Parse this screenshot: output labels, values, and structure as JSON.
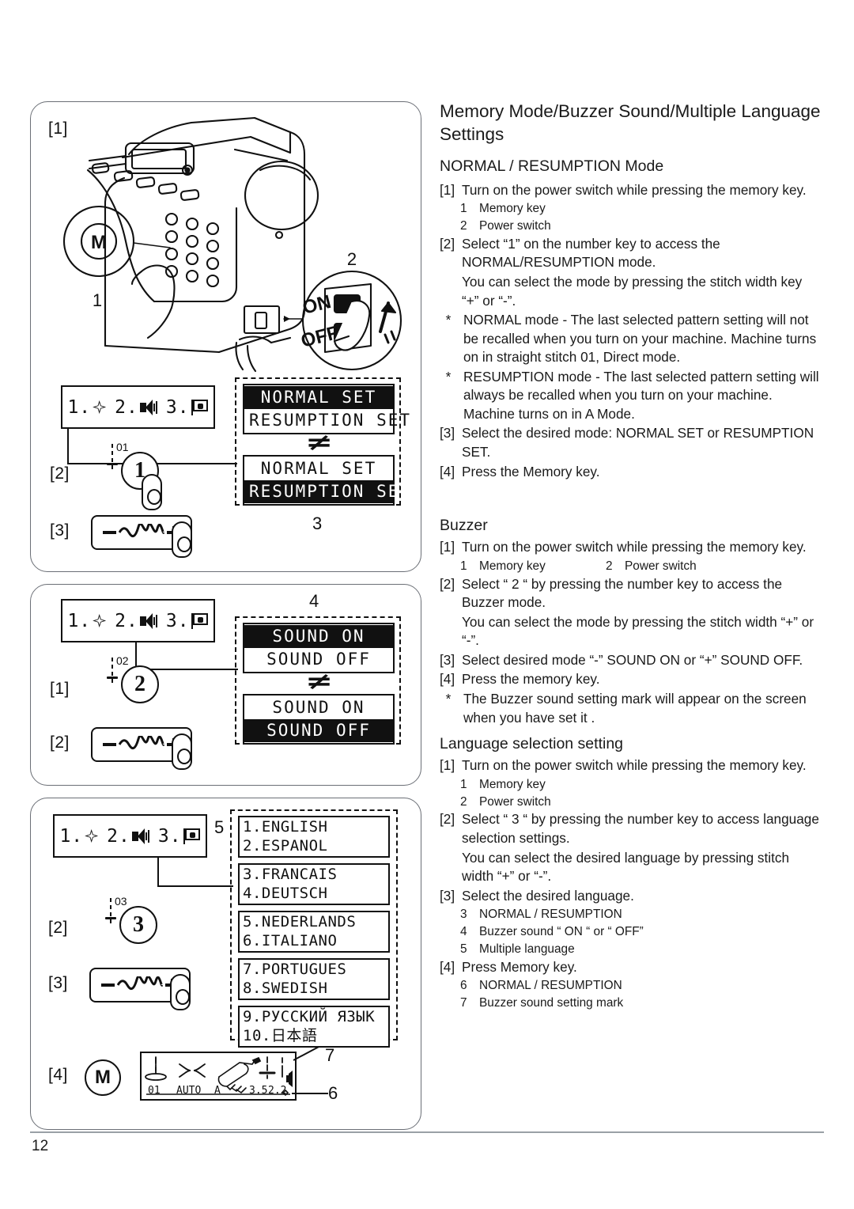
{
  "page": {
    "number": "12"
  },
  "title": "Memory Mode/Buzzer Sound/Multiple Language Settings",
  "sections": [
    {
      "heading": "NORMAL / RESUMPTION Mode",
      "steps": [
        {
          "marker": "[1]",
          "text": "Turn on the power switch while pressing the memory key."
        },
        {
          "marker": "[2]",
          "text": "Select “1”  on the number key to access the NORMAL/RESUMPTION mode."
        },
        {
          "marker": "",
          "text": "You can select the mode by pressing the stitch width key “+” or “-”."
        },
        {
          "marker": "*",
          "text": "NORMAL mode - The last selected pattern setting will not be recalled when you turn on your machine. Machine turns on in straight stitch 01, Direct mode."
        },
        {
          "marker": "*",
          "text": "RESUMPTION mode - The last selected pattern setting will always be recalled  when you turn on your machine. Machine turns on in A Mode."
        },
        {
          "marker": "[3]",
          "text": "Select the desired mode:  NORMAL SET or RESUMPTION SET."
        },
        {
          "marker": "[4]",
          "text": "Press the Memory key."
        }
      ],
      "sub_items": [
        {
          "n": "1",
          "label": "Memory key"
        },
        {
          "n": "2",
          "label": "Power switch"
        }
      ]
    },
    {
      "heading": "Buzzer",
      "steps": [
        {
          "marker": "[1]",
          "text": "Turn on the power switch while pressing the memory key."
        },
        {
          "marker": "[2]",
          "text": "Select “ 2 “ by pressing the number key to access the Buzzer mode."
        },
        {
          "marker": "",
          "text": "You can select the mode by pressing the stitch width “+” or “-”."
        },
        {
          "marker": "[3]",
          "text": "Select desired mode “-”  SOUND ON or “+” SOUND OFF."
        },
        {
          "marker": "[4]",
          "text": "Press the memory key."
        },
        {
          "marker": "*",
          "text": "The Buzzer sound setting mark will appear on the screen when you have set it ."
        }
      ],
      "sub_items": [
        {
          "n": "1",
          "label": "Memory key"
        },
        {
          "n": "2",
          "label": "Power switch"
        }
      ]
    },
    {
      "heading": "Language selection setting",
      "steps": [
        {
          "marker": "[1]",
          "text": "Turn on the power switch while pressing the memory key."
        },
        {
          "marker": "[2]",
          "text": "Select “ 3 “ by pressing the number key to access language selection settings."
        },
        {
          "marker": "",
          "text": "You can select the desired language by pressing stitch width “+” or “-”."
        },
        {
          "marker": "[3]",
          "text": "Select the desired language."
        },
        {
          "marker": "[4]",
          "text": "Press Memory key."
        }
      ],
      "sub_items": [
        {
          "n": "1",
          "label": "Memory key"
        },
        {
          "n": "2",
          "label": "Power switch"
        }
      ],
      "sub_items_b": [
        {
          "n": "3",
          "label": "NORMAL / RESUMPTION"
        },
        {
          "n": "4",
          "label": "Buzzer sound  “ ON “ or “ OFF”"
        },
        {
          "n": "5",
          "label": "Multiple language"
        }
      ],
      "sub_items_c": [
        {
          "n": "6",
          "label": "NORMAL / RESUMPTION"
        },
        {
          "n": "7",
          "label": "Buzzer sound setting mark"
        }
      ]
    }
  ],
  "figures": {
    "panel1": {
      "step_tags": [
        "[1]",
        "[2]",
        "[3]"
      ],
      "machine_labels": {
        "memory_key": "1",
        "power_switch": "2",
        "switch_on": "ON",
        "switch_off": "OFF",
        "memory_icon": "M"
      },
      "menu_items": [
        {
          "num": "1.",
          "icon": "diamond-icon"
        },
        {
          "num": "2.",
          "icon": "speaker-icon"
        },
        {
          "num": "3.",
          "icon": "flag-icon"
        }
      ],
      "numkey": {
        "code": "01",
        "label": "1"
      },
      "display_top": {
        "lines": [
          "NORMAL SET",
          "RESUMPTION SET"
        ],
        "selected": 0
      },
      "display_bottom": {
        "lines": [
          "NORMAL SET",
          "RESUMPTION SET"
        ],
        "selected": 1
      },
      "callout": "3"
    },
    "panel2": {
      "step_tags": [
        "[1]",
        "[2]"
      ],
      "menu_items": [
        {
          "num": "1.",
          "icon": "diamond-icon"
        },
        {
          "num": "2.",
          "icon": "speaker-icon"
        },
        {
          "num": "3.",
          "icon": "flag-icon"
        }
      ],
      "numkey": {
        "code": "02",
        "label": "2"
      },
      "display_top": {
        "lines": [
          "SOUND ON",
          "SOUND OFF"
        ],
        "selected": 0
      },
      "display_bottom": {
        "lines": [
          "SOUND ON",
          "SOUND OFF"
        ],
        "selected": 1
      },
      "callout": "4"
    },
    "panel3": {
      "step_tags": [
        "[2]",
        "[3]",
        "[4]"
      ],
      "menu_items": [
        {
          "num": "1.",
          "icon": "diamond-icon"
        },
        {
          "num": "2.",
          "icon": "speaker-icon"
        },
        {
          "num": "3.",
          "icon": "flag-icon"
        }
      ],
      "numkey": {
        "code": "03",
        "label": "3"
      },
      "callout": "5",
      "memory_key_label": "M",
      "language_boxes": [
        {
          "lines": [
            "1.ENGLISH",
            "2.ESPANOL"
          ],
          "selected": 0
        },
        {
          "lines": [
            "3.FRANCAIS",
            "4.DEUTSCH"
          ],
          "selected": -1
        },
        {
          "lines": [
            "5.NEDERLANDS",
            "6.ITALIANO"
          ],
          "selected": -1
        },
        {
          "lines": [
            "7.PORTUGUES",
            "8.SWEDISH"
          ],
          "selected": -1
        },
        {
          "lines": [
            "9.РУССКИЙ ЯЗЫК",
            "10.日本語"
          ],
          "selected": -1
        }
      ],
      "status_lcd": {
        "pattern_number": "01",
        "tension": "AUTO",
        "mode": "A",
        "width": "3.5",
        "length": "2.2"
      },
      "callout_6": "6",
      "callout_7": "7"
    }
  }
}
